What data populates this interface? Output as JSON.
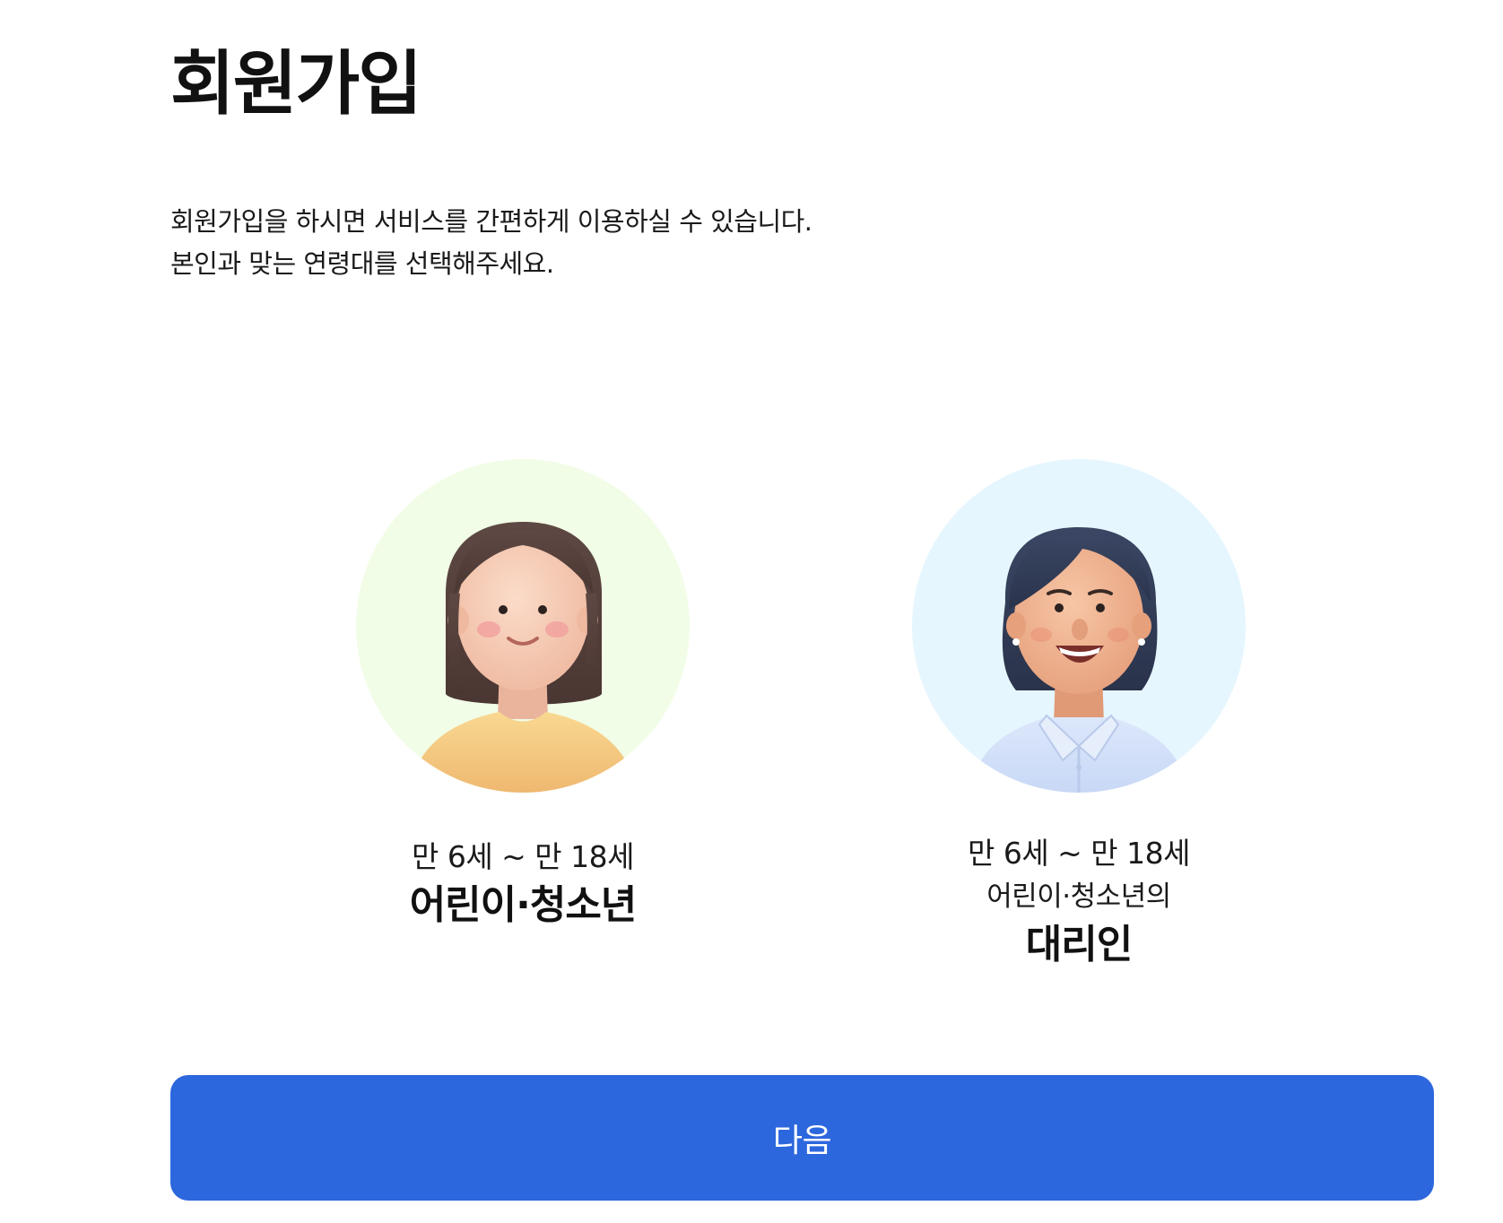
{
  "page": {
    "title": "회원가입",
    "intro_line1": "회원가입을 하시면 서비스를 간편하게 이용하실 수 있습니다.",
    "intro_line2": "본인과 맞는 연령대를 선택해주세요."
  },
  "options": [
    {
      "age_range": "만 6세 ~ 만 18세",
      "label": "어린이·청소년",
      "avatar_icon": "girl-avatar-icon",
      "background_color": "#f1fde6"
    },
    {
      "age_range": "만 6세 ~ 만 18세",
      "sub_label": "어린이·청소년의",
      "label": "대리인",
      "avatar_icon": "woman-avatar-icon",
      "background_color": "#e6f6fe"
    }
  ],
  "next_button": {
    "label": "다음"
  },
  "colors": {
    "accent": "#2d67dd",
    "text": "#111111"
  }
}
